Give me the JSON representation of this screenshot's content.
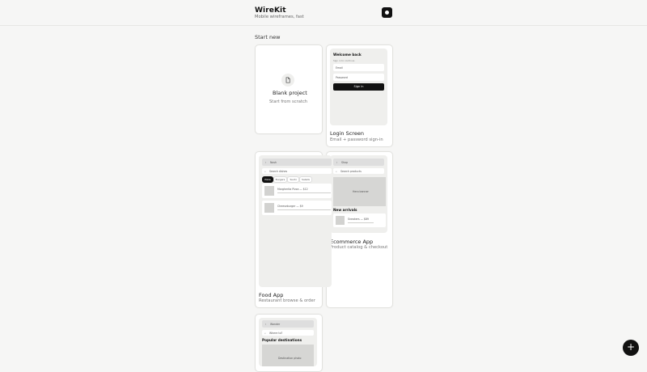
{
  "app": {
    "name": "WireKit",
    "tagline": "Mobile wireframes, fast"
  },
  "section_title": "Start new",
  "blank": {
    "title": "Blank project",
    "subtitle": "Start from scratch"
  },
  "templates": [
    {
      "title": "Login Screen",
      "subtitle": "Email + password sign-in",
      "preview": {
        "heading": "Welcome back",
        "subheading": "Sign in to continue",
        "email_placeholder": "Email",
        "password_placeholder": "Password",
        "button": "Sign in"
      }
    },
    {
      "title": "Food App",
      "subtitle": "Restaurant browse & order",
      "preview": {
        "nav": "Nosh",
        "search": "Search dishes",
        "chips": [
          "Pizza",
          "Burgers",
          "Sushi",
          "Salads"
        ],
        "items": [
          "Margherita Pizza — $12",
          "Cheeseburger — $9"
        ]
      }
    },
    {
      "title": "Ecommerce App",
      "subtitle": "Product catalog & checkout",
      "preview": {
        "nav": "Shop",
        "search": "Search products",
        "banner": "Hero banner",
        "section": "New arrivals",
        "item": "Sneakers — $89"
      }
    },
    {
      "title": "Travel App",
      "subtitle": "",
      "preview": {
        "nav": "Wander",
        "search": "Where to?",
        "section": "Popular destinations",
        "image": "Destination photo"
      }
    }
  ],
  "icons": {
    "logo": "logo-mark-icon",
    "blank": "document-icon",
    "fab": "plus-icon"
  }
}
